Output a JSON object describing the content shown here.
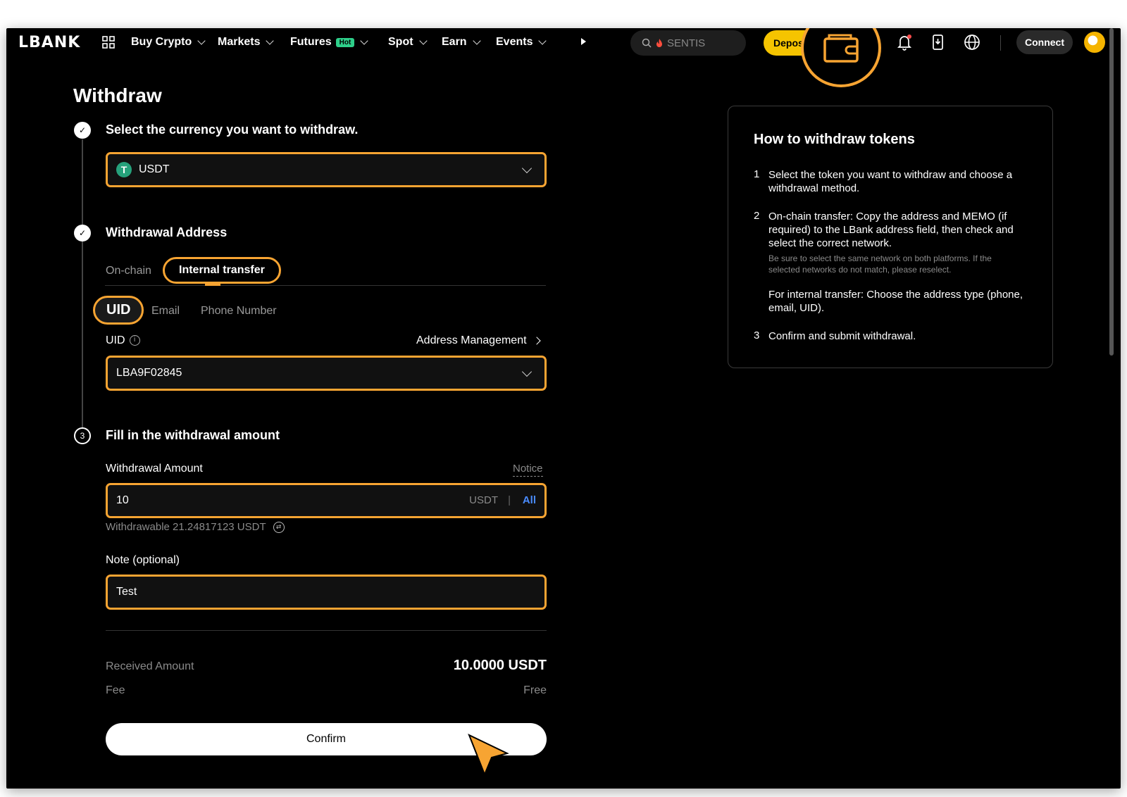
{
  "nav": {
    "logo": "LBANK",
    "menu": [
      {
        "label": "Buy Crypto"
      },
      {
        "label": "Markets"
      },
      {
        "label": "Futures",
        "badge": "Hot"
      },
      {
        "label": "Spot"
      },
      {
        "label": "Earn"
      },
      {
        "label": "Events"
      }
    ],
    "search_placeholder": "SENTIS",
    "deposit_label": "Deposit",
    "connect_label": "Connect"
  },
  "page": {
    "title": "Withdraw"
  },
  "step1": {
    "title": "Select the currency you want to withdraw.",
    "currency": "USDT",
    "currency_icon": "T"
  },
  "step2": {
    "title": "Withdrawal Address",
    "tabs": [
      "On-chain",
      "Internal transfer"
    ],
    "active_tab": "Internal transfer",
    "subtabs": [
      "UID",
      "Email",
      "Phone Number"
    ],
    "active_subtab": "UID",
    "uid_label": "UID",
    "address_management": "Address Management",
    "uid_value": "LBA9F02845"
  },
  "step3": {
    "number": "3",
    "title": "Fill in the withdrawal amount",
    "amount_label": "Withdrawal Amount",
    "notice": "Notice",
    "amount_value": "10",
    "amount_unit": "USDT",
    "pipe": "|",
    "all_label": "All",
    "withdrawable": "Withdrawable 21.24817123 USDT",
    "note_label": "Note (optional)",
    "note_value": "Test",
    "received_label": "Received Amount",
    "received_value": "10.0000 USDT",
    "fee_label": "Fee",
    "fee_value": "Free",
    "confirm_label": "Confirm"
  },
  "guide": {
    "title": "How to withdraw tokens",
    "steps": [
      {
        "num": "1",
        "text": "Select the token you want to withdraw and choose a withdrawal method."
      },
      {
        "num": "2",
        "text": "On-chain transfer: Copy the address and MEMO (if required) to the LBank address field, then check and select the correct network.",
        "note": "Be sure to select the same network on both platforms. If the selected networks do not match, please reselect.",
        "extra": "For internal transfer: Choose the address type (phone, email, UID)."
      },
      {
        "num": "3",
        "text": "Confirm and submit withdrawal."
      }
    ]
  },
  "colors": {
    "highlight": "#f7a432",
    "deposit": "#f5c400",
    "link": "#4a8cff",
    "hot_badge": "#2ecf8a"
  }
}
